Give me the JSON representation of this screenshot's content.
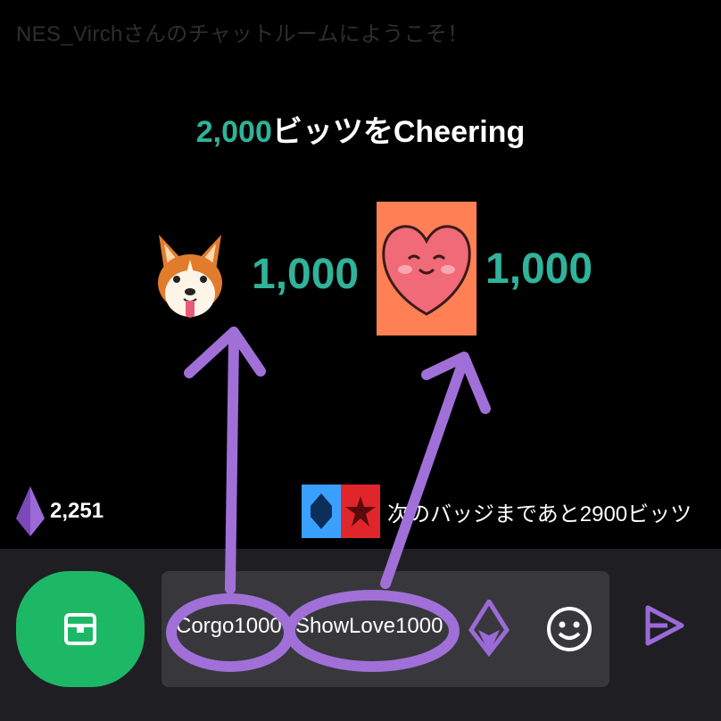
{
  "header": {
    "welcome": "NES_Virchさんのチャットルームにようこそ！"
  },
  "cheer": {
    "amount": "2,000",
    "suffix": "ビッツをCheering",
    "items": [
      {
        "emote": "corgi-emote",
        "count": "1,000"
      },
      {
        "emote": "heart-emote",
        "count": "1,000"
      }
    ]
  },
  "status": {
    "bits_balance": "2,251",
    "next_badge_text": "次のバッジまであと2900ビッツ"
  },
  "input": {
    "chips": [
      "Corgo1000",
      "ShowLove1000"
    ]
  },
  "colors": {
    "accent_green": "#2fb39a",
    "store_green": "#1db866",
    "purple": "#9b6ad8",
    "annotation_purple": "#a070d8"
  },
  "icons": [
    "bits-icon",
    "store-icon",
    "emote-face-icon",
    "send-icon"
  ]
}
